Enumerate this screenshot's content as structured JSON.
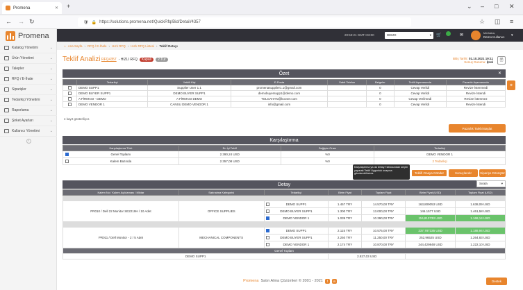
{
  "browser": {
    "tab_title": "Promena",
    "url": "https://solutions.promena.net/QuickRfq/Bid/Detail/4357"
  },
  "app": {
    "logo": "Promena",
    "time": "20:53:21 GMT+03:00",
    "company": "DEMO",
    "user_greeting": "Merhaba,",
    "user_name": "Demo Kullanıcı"
  },
  "sidebar": {
    "items": [
      {
        "label": "Katalog Yönetimi"
      },
      {
        "label": "Ürün Yönetimi"
      },
      {
        "label": "Talepler"
      },
      {
        "label": "RFQ / E-İhale"
      },
      {
        "label": "Siparişler"
      },
      {
        "label": "Tedarikçi Yönetimi"
      },
      {
        "label": "Raporlama"
      },
      {
        "label": "Şirket Ayarları"
      },
      {
        "label": "Kullanıcı Yönetimi"
      }
    ]
  },
  "breadcrumb": [
    "Ana Sayfa",
    "RFQ / E-İhale",
    "Hızlı RFQ",
    "Hızlı RFQ Listesi",
    "Teklif Detayı"
  ],
  "header": {
    "title": "Teklif Analizi",
    "code": "RFQ4357",
    "subtitle": "- HIZLI RFQ",
    "badge1": "Kapalı",
    "badge2": "2.Tur",
    "start_label": "Bitiş Tarihi:",
    "start_value": "01.10.2021 19:11",
    "status_label": "Sonuç Durumu:",
    "status_value": "İptal"
  },
  "summary": {
    "title": "Özet",
    "columns": [
      "Tedarikçi",
      "Yetkili Kişi",
      "E-Posta",
      "Sabit Telefon",
      "Belgeler",
      "Teklif Aşamasında",
      "Pazarlık Aşamasında"
    ],
    "rows": [
      [
        "DEMO SUPP1",
        "Supplier User 1.1",
        "promenasupplier1.1@gmail.com",
        "",
        "0",
        "Cevap Verildi",
        "Revize İstenmedi"
      ],
      [
        "DEMO BUYER SUPP1",
        "DEMO BUYER SUPP1",
        "demobuyersupp1@demo.com",
        "",
        "0",
        "Cevap Verildi",
        "Revize İstendi"
      ],
      [
        "A FİRMASI - DEMO",
        "A FİRMASI DEMO",
        "TOLGAHAN@kocser.com",
        "",
        "0",
        "Cevap Verilmedi",
        "Revize İstenmez"
      ],
      [
        "DEMO VENDOR 1",
        "CANSU DEMO VENDOR 1",
        "info@gmail.com",
        "",
        "0",
        "Cevap Verildi",
        "Revize İstendi"
      ]
    ],
    "count_text": "4 kayıt gösteriliyor.",
    "btn_pazarlik": "Pazarlık Talebi Başlat"
  },
  "comparison": {
    "title": "Karşılaştırma",
    "columns": [
      "Karşılaştırma Türü",
      "En İyi Teklif",
      "Değişim Oranı",
      "Tedarikçi"
    ],
    "rows": [
      [
        "Genel Toplamı",
        "2.390,24 USD",
        "%0",
        "DEMO VENDOR 1"
      ],
      [
        "Kalem Bazında",
        "2.357,08 USD",
        "%0",
        "2 Tedarikçi"
      ]
    ],
    "tooltip": "Karşılaştırma ya da Detay Tablosundan seçim yaparak Teklif Uygunluk onayına gönderebilirsiniz.",
    "btn_approve": "Teklifi Onaya Gönder",
    "btn_sent": "Sonuçlandır",
    "btn_transfer": "Siparişe Dönüştür"
  },
  "detail": {
    "title": "Detay",
    "sort_label": "Sırala",
    "columns": [
      "Kalem No / Kalem Açıklaması / Miktar",
      "Satınalma Kategorisi",
      "Tedarikçi",
      "Birim Fiyat",
      "Toplam Fiyat",
      "Birim Fiyat (USD)",
      "Toplam Fiyat (USD)"
    ],
    "items": [
      {
        "name": "PR010 / Dell 22 Monitor SE2219H / 10 Adet",
        "category": "OFFICE SUPPLIES",
        "rows": [
          [
            "DEMO SUPP1",
            "1.457 TRY",
            "14.570,00 TRY",
            "163,809053 USD",
            "1.638,09 USD"
          ],
          [
            "DEMO BUYER SUPP1",
            "1.300 TRY",
            "13.000,00 TRY",
            "146.1577 USD",
            "1.461,58 USD"
          ],
          [
            "DEMO VENDOR 1",
            "1.039 TRY",
            "10.390,00 TRY",
            "116,813733 USD",
            "1.168,14 USD"
          ]
        ]
      },
      {
        "name": "PR011 / Dell Monitor - 2 / 5 Adet",
        "category": "MECHANICAL COMPONENTS",
        "rows": [
          [
            "DEMO SUPP1",
            "2.115 TRY",
            "10.575,00 TRY",
            "237,787335 USD",
            "1.188,94 USD"
          ],
          [
            "DEMO BUYER SUPP1",
            "2.250 TRY",
            "11.250,00 TRY",
            "252,96525 USD",
            "1.264,83 USD"
          ],
          [
            "DEMO VENDOR 1",
            "2.174 TRY",
            "10.870,00 TRY",
            "244,429848 USD",
            "1.222,10 USD"
          ]
        ]
      }
    ],
    "total_label": "Genel Toplam",
    "total_row": [
      "DEMO SUPP1",
      "2.827,03 USD"
    ]
  },
  "footer": {
    "brand": "Promena",
    "text": "Satın Alma Çözümleri © 2001 - 2021",
    "destek": "Destek"
  }
}
